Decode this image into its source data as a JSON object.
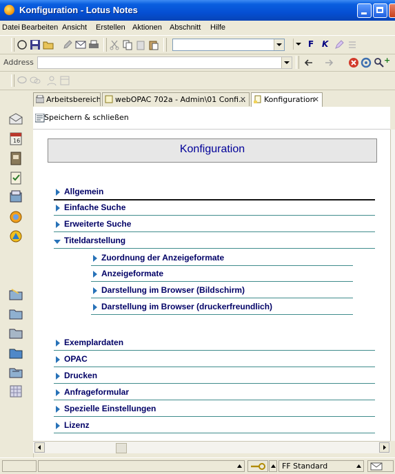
{
  "window": {
    "title": "Konfiguration - Lotus Notes"
  },
  "menu": [
    "Datei",
    "Bearbeiten",
    "Ansicht",
    "Erstellen",
    "Aktionen",
    "Abschnitt",
    "Hilfe"
  ],
  "toolbar": {
    "address_label": "Address",
    "format_bold": "F",
    "format_italic": "K"
  },
  "tabs": [
    {
      "label": "Arbeitsbereich",
      "closable": false
    },
    {
      "label": "webOPAC 702a - Admin\\01 Confi...",
      "closable": true
    },
    {
      "label": "Konfiguration",
      "closable": true,
      "active": true
    }
  ],
  "action_bar": {
    "save_label": "Speichern & schließen"
  },
  "document": {
    "heading": "Konfiguration",
    "sections": [
      {
        "label": "Allgemein",
        "expanded": false
      },
      {
        "label": "Einfache Suche",
        "expanded": false
      },
      {
        "label": "Erweiterte Suche",
        "expanded": false
      },
      {
        "label": "Titeldarstellung",
        "expanded": true,
        "children": [
          "Zuordnung der Anzeigeformate",
          "Anzeigeformate",
          "Darstellung im Browser (Bildschirm)",
          "Darstellung im Browser (druckerfreundlich)"
        ]
      },
      {
        "label": "Exemplardaten",
        "expanded": false
      },
      {
        "label": "OPAC",
        "expanded": false
      },
      {
        "label": "Drucken",
        "expanded": false
      },
      {
        "label": "Anfrageformular",
        "expanded": false
      },
      {
        "label": "Spezielle Einstellungen",
        "expanded": false
      },
      {
        "label": "Lizenz",
        "expanded": false
      }
    ]
  },
  "status": {
    "style_name": "FF Standard"
  }
}
